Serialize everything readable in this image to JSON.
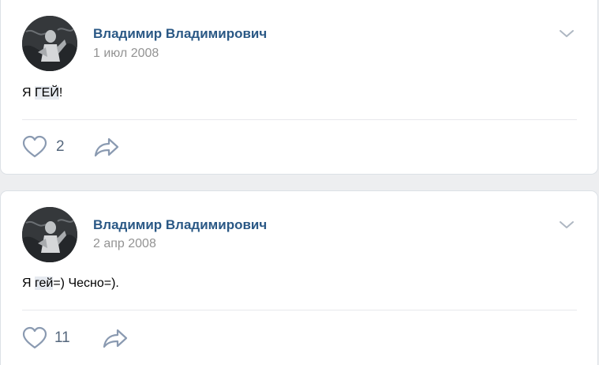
{
  "posts": [
    {
      "author": "Владимир Владимирович",
      "date": "1 июл 2008",
      "text_before": "Я ",
      "text_highlight": "ГЕЙ",
      "text_after": "!",
      "likes": "2"
    },
    {
      "author": "Владимир Владимирович",
      "date": "2 апр 2008",
      "text_before": "Я ",
      "text_highlight": "гей",
      "text_after": "=) Чесно=).",
      "likes": "11"
    }
  ],
  "icons": {
    "like": "heart-icon",
    "share": "share-arrow-icon",
    "menu": "chevron-down-icon"
  },
  "colors": {
    "author": "#2a5885",
    "date": "#939393",
    "icons": "#8a9ab1",
    "highlight": "#e6eaf0"
  }
}
